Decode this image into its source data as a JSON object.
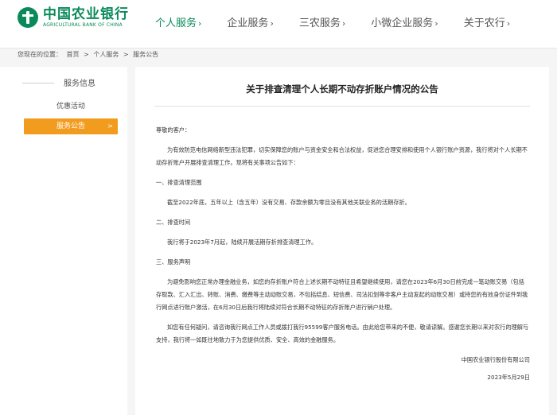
{
  "brand": {
    "name_cn": "中国农业银行",
    "name_en": "AGRICULTURAL BANK OF CHINA",
    "color": "#0a8a5a"
  },
  "nav": [
    {
      "label": "个人服务",
      "chevron": "›",
      "active": true
    },
    {
      "label": "企业服务",
      "chevron": "›",
      "active": false
    },
    {
      "label": "三农服务",
      "chevron": "›",
      "active": false
    },
    {
      "label": "小微企业服务",
      "chevron": "›",
      "active": false
    },
    {
      "label": "关于农行",
      "chevron": "›",
      "active": false
    }
  ],
  "breadcrumb": {
    "prefix": "您现在的位置：",
    "items": [
      "首页",
      ">",
      "个人服务",
      ">",
      "服务公告"
    ]
  },
  "sidebar": {
    "title": "服务信息",
    "items": [
      {
        "label": "优惠活动"
      },
      {
        "label": "服务公告",
        "arrow": ">"
      }
    ],
    "accent": "#f29c1f"
  },
  "article": {
    "title": "关于排查清理个人长期不动存折账户情况的公告",
    "salutation": "尊敬的客户：",
    "intro": "为有效防范电信网络新型违法犯罪，切实保障您的账户与资金安全和合法权益，促进您合理安排和使用个人银行账户资源，我行将对个人长期不动存折账户开展排查清理工作。现将有关事项公告如下：",
    "sections": [
      {
        "heading": "一、排查清理范围",
        "text": "截至2022年底，五年以上（含五年）没有交易、存款余额为零且没有其他关联业务的活期存折。"
      },
      {
        "heading": "二、排查时间",
        "text": "我行将于2023年7月起，陆续开展活期存折排查清理工作。"
      },
      {
        "heading": "三、服务声明",
        "text": "为避免影响您正常办理金融业务，如您的存折账户符合上述长期不动特征且希望继续使用，请您在2023年6月30日前完成一笔动账交易（包括存取款、汇入汇出、转账、消费、缴费等主动动账交易，不包括结息、短信费、司法扣划等非客户主动发起的动账交易）或持您的有效身份证件到我行网点进行账户激活，在6月30日后我行将陆续对符合长期不动特征的存折账户进行销户处理。"
      }
    ],
    "closing": "如您有任何疑问，请咨询我行网点工作人员或拨打我行95599客户服务电话。由此给您带来的不便，敬请谅解。感谢您长期以来对农行的理解与支持，我行将一如既往地致力于为您提供优质、安全、高效的金融服务。",
    "signature": "中国农业银行股份有限公司",
    "date": "2023年5月29日"
  }
}
